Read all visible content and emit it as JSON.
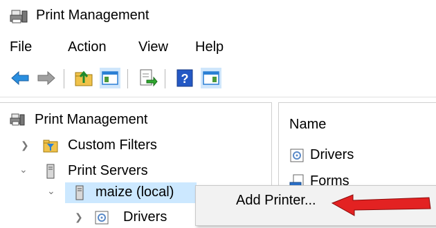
{
  "window": {
    "title": "Print Management"
  },
  "menu": [
    "File",
    "Action",
    "View",
    "Help"
  ],
  "toolbar": {
    "icons": [
      "back-arrow-icon",
      "forward-arrow-icon",
      "up-folder-icon",
      "show-hide-tree-icon",
      "export-list-icon",
      "help-icon",
      "action-pane-icon"
    ]
  },
  "tree": {
    "root": "Print Management",
    "custom_filters": "Custom Filters",
    "print_servers": "Print Servers",
    "server": "maize (local)",
    "drivers": "Drivers"
  },
  "list": {
    "column": "Name",
    "items": [
      "Drivers",
      "Forms"
    ]
  },
  "context_menu": {
    "item": "Add Printer..."
  },
  "colors": {
    "selection": "#cce8ff",
    "arrow": "#e32222",
    "accent": "#2a7fd4"
  }
}
